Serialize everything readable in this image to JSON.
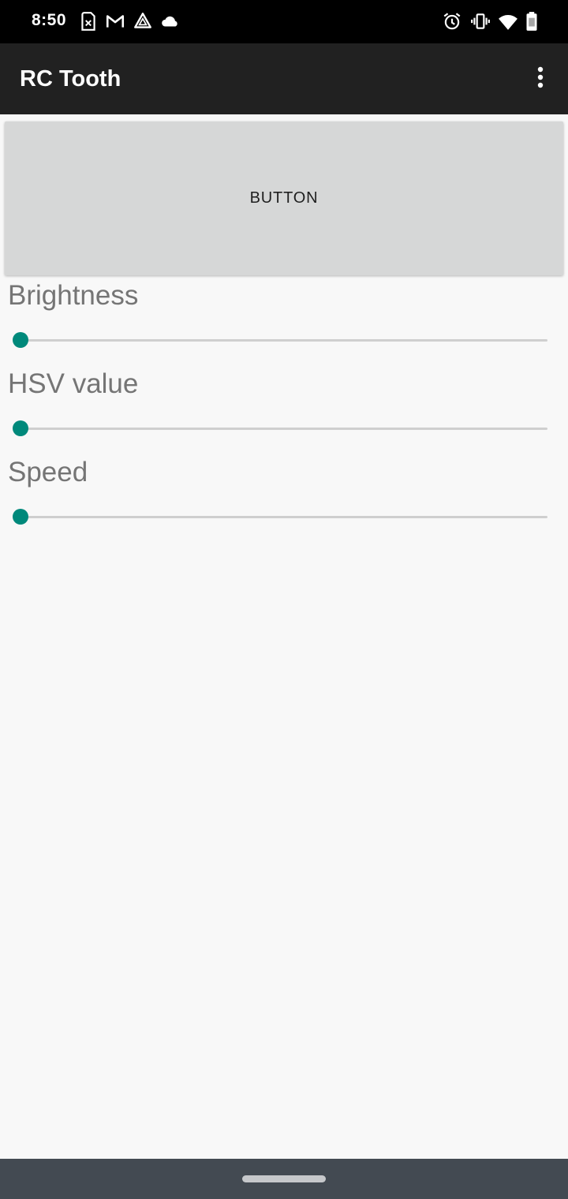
{
  "status_bar": {
    "time": "8:50",
    "left_icons": [
      "sim-card-icon",
      "gmail-icon",
      "drive-icon",
      "cloud-icon"
    ],
    "right_icons": [
      "alarm-icon",
      "vibrate-icon",
      "wifi-icon",
      "battery-icon"
    ]
  },
  "app_bar": {
    "title": "RC Tooth",
    "overflow_icon": "more-vert-icon"
  },
  "main": {
    "button_label": "BUTTON",
    "sliders": [
      {
        "label": "Brightness",
        "value": 0
      },
      {
        "label": "HSV value",
        "value": 0
      },
      {
        "label": "Speed",
        "value": 0
      }
    ]
  },
  "colors": {
    "accent": "#00897b",
    "app_bar": "#212121",
    "status_bar": "#000000",
    "nav_bar": "#434a52",
    "button": "#d6d7d7",
    "background": "#f8f8f8"
  }
}
